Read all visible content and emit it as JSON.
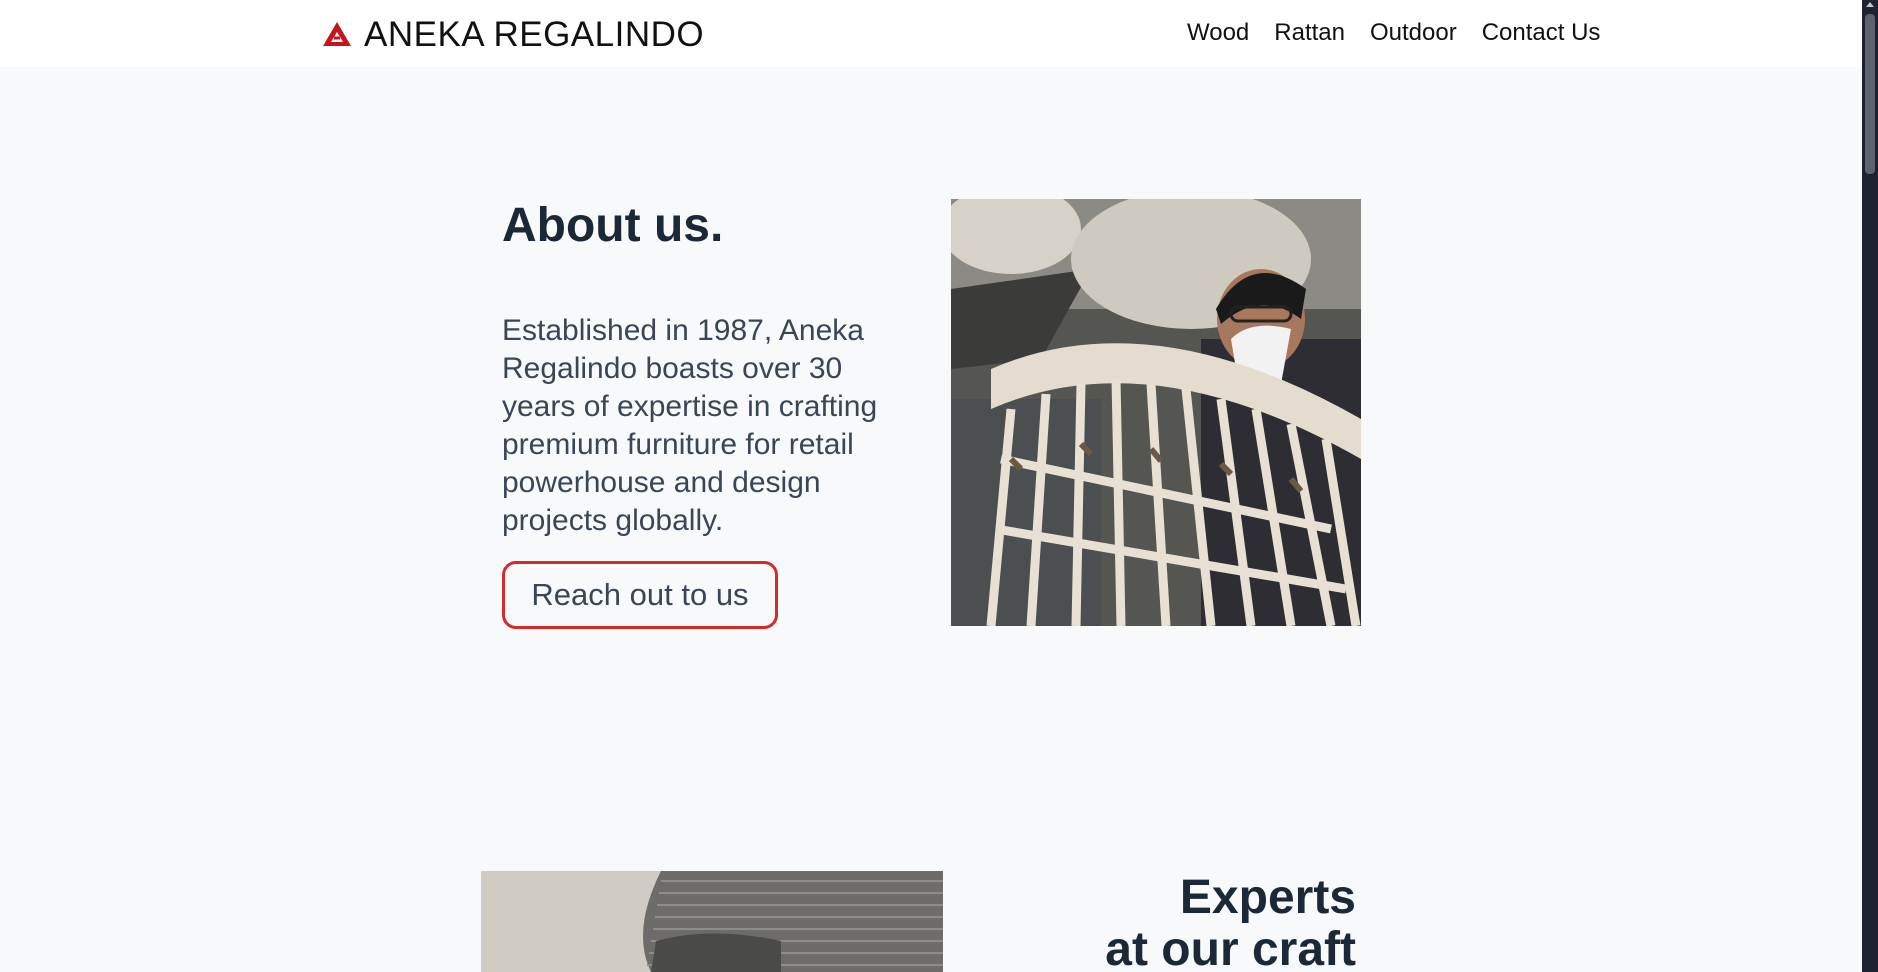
{
  "brand": {
    "name": "ANEKA REGALINDO",
    "logo_icon": "triangle-logo-icon",
    "accent_color": "#c4161c"
  },
  "nav": {
    "items": [
      "Wood",
      "Rattan",
      "Outdoor",
      "Contact Us"
    ]
  },
  "about": {
    "title": "About us.",
    "text": "Established in 1987, Aneka Regalindo boasts over 30 years of expertise in crafting premium furniture for retail powerhouse and design projects globally.",
    "cta_label": "Reach out to us",
    "cta_border_color": "#d32b2b"
  },
  "experts": {
    "title_line1": "Experts",
    "title_line2": "at our craft"
  }
}
